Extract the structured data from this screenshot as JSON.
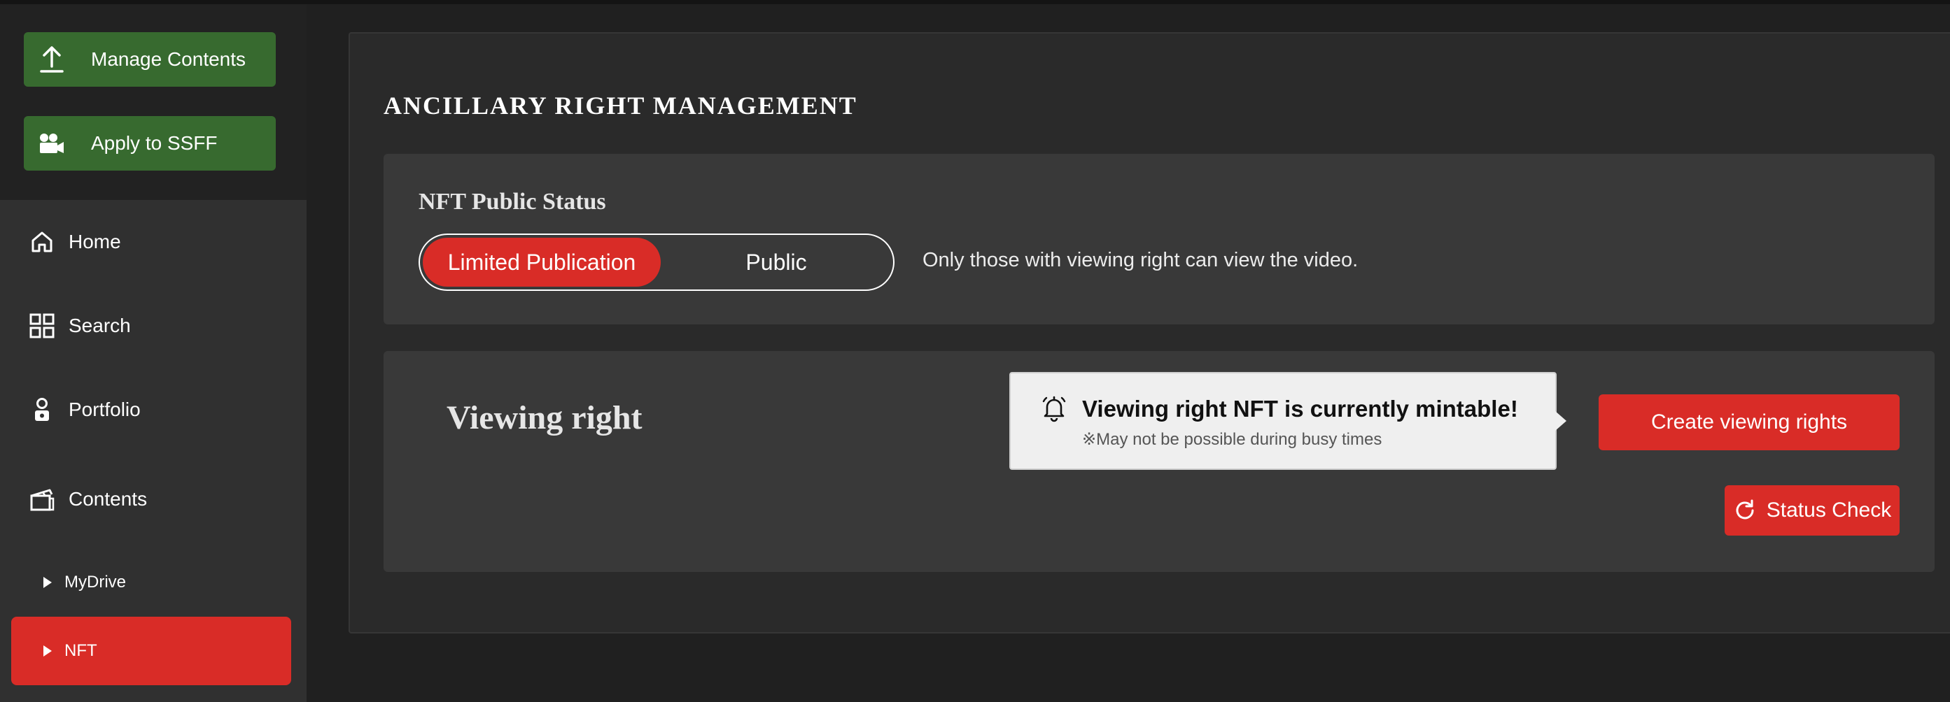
{
  "sidebar": {
    "actions": [
      {
        "label": "Manage Contents",
        "icon": "upload-icon"
      },
      {
        "label": "Apply to SSFF",
        "icon": "video-camera-icon"
      }
    ],
    "nav": [
      {
        "label": "Home",
        "icon": "home-icon"
      },
      {
        "label": "Search",
        "icon": "grid-icon"
      },
      {
        "label": "Portfolio",
        "icon": "person-badge-icon"
      },
      {
        "label": "Contents",
        "icon": "clapperboard-icon"
      }
    ],
    "sub_items": [
      {
        "label": "MyDrive",
        "active": false
      },
      {
        "label": "NFT",
        "active": true
      }
    ]
  },
  "main": {
    "title": "ANCILLARY RIGHT MANAGEMENT",
    "public_status": {
      "heading": "NFT Public Status",
      "options": [
        "Limited Publication",
        "Public"
      ],
      "selected": "Limited Publication",
      "description": "Only those with viewing right can view the video."
    },
    "viewing_right": {
      "heading": "Viewing right",
      "tooltip": {
        "message": "Viewing right NFT is currently mintable!",
        "note": "※May not be possible during busy times",
        "icon": "bell-icon"
      },
      "create_button": "Create viewing rights",
      "status_button": "Status Check"
    }
  },
  "colors": {
    "accent_red": "#d92c27",
    "action_green": "#376a2f",
    "sidebar_bg": "#303030",
    "card_bg": "#393939"
  }
}
